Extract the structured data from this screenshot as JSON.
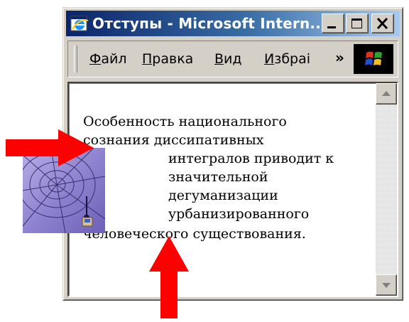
{
  "window": {
    "title": "Отступы - Microsoft Intern..."
  },
  "menubar": {
    "items": [
      {
        "label": "Файл"
      },
      {
        "label": "Правка"
      },
      {
        "label": "Вид"
      },
      {
        "label": "Избраі"
      }
    ],
    "overflow_label": "»"
  },
  "document": {
    "lines": [
      "Особенность национального",
      "сознания диссипативных",
      "интегралов приводит к",
      "значительной",
      "дегуманизации",
      "урбанизированного",
      "человеческого существования."
    ]
  },
  "annotations": {
    "arrow_color": "#ff0000"
  },
  "colors": {
    "title_gradient_start": "#0a246a",
    "title_gradient_end": "#a6caf0",
    "chrome": "#d4d0c8"
  }
}
